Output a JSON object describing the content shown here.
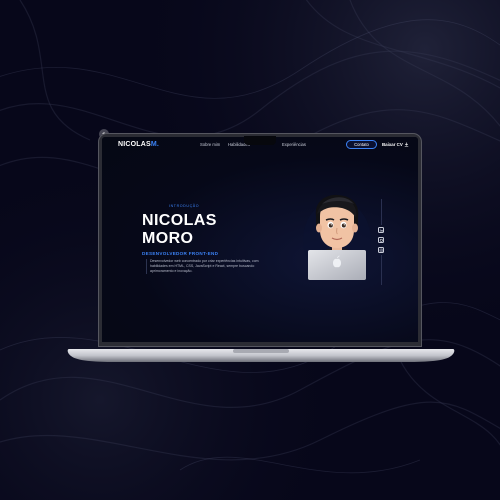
{
  "nav": {
    "brand_main": "NICOLAS",
    "brand_accent": "M.",
    "links": [
      "Sobre mim",
      "Habilidades",
      "Experiências"
    ],
    "contact_label": "Contato",
    "cv_label": "Baixar CV"
  },
  "hero": {
    "eyebrow": "INTRODUÇÃO",
    "name_line1": "NICOLAS",
    "name_line2": "MORO",
    "role": "DESENVOLVEDOR FRONT-END",
    "description": "Desenvolvedor web concentrado por criar experiências intuitivas, com habilidades em HTML, CSS, JavaScript e React, sempre buscando aprimoramento e inovação."
  },
  "socials": [
    "linkedin-icon",
    "github-icon",
    "instagram-icon"
  ],
  "colors": {
    "accent": "#3b82f6",
    "background": "#07071a",
    "screen": "#050814"
  }
}
